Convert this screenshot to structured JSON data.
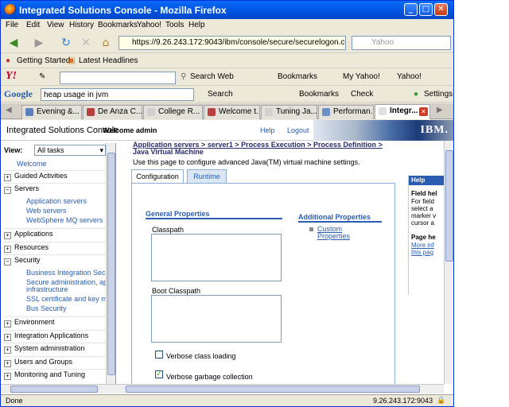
{
  "window": {
    "title": "Integrated Solutions Console - Mozilla Firefox"
  },
  "menu": {
    "items": [
      "File",
      "Edit",
      "View",
      "History",
      "Bookmarks",
      "Yahoo!",
      "Tools",
      "Help"
    ]
  },
  "navigation": {
    "url": "https://9.26.243.172:9043/ibm/console/secure/securelogon.c",
    "search_placeholder": "Yahoo"
  },
  "bookmarks_toolbar": {
    "getting_started": "Getting Started",
    "latest_headlines": "Latest Headlines"
  },
  "yahoo_toolbar": {
    "search_web": "Search Web",
    "bookmarks": "Bookmarks",
    "my_yahoo": "My Yahoo!",
    "yahoo": "Yahoo!"
  },
  "google_toolbar": {
    "query": "heap usage in jvm",
    "search": "Search",
    "bookmarks": "Bookmarks",
    "check": "Check",
    "settings": "Settings"
  },
  "tabs": [
    "Evening &...",
    "De Anza C...",
    "College R...",
    "Welcome t...",
    "Tuning Ja...",
    "Performan...",
    "Integr..."
  ],
  "console": {
    "title": "Integrated Solutions Console",
    "welcome": "Welcome admin",
    "help_link": "Help",
    "logout_link": "Logout",
    "brand": "IBM."
  },
  "sidebar": {
    "view_label": "View:",
    "view_value": "All tasks",
    "welcome": "Welcome",
    "categories": [
      {
        "label": "Guided Activities",
        "expanded": false
      },
      {
        "label": "Servers",
        "expanded": true,
        "children": [
          "Application servers",
          "Web servers",
          "WebSphere MQ servers"
        ]
      },
      {
        "label": "Applications",
        "expanded": false
      },
      {
        "label": "Resources",
        "expanded": false
      },
      {
        "label": "Security",
        "expanded": true,
        "children": [
          "Business Integration Secur",
          "Secure administration, appl",
          "infrastructure",
          "SSL certificate and key mar",
          "Bus Security"
        ]
      },
      {
        "label": "Environment",
        "expanded": false
      },
      {
        "label": "Integration Applications",
        "expanded": false
      },
      {
        "label": "System administration",
        "expanded": false
      },
      {
        "label": "Users and Groups",
        "expanded": false
      },
      {
        "label": "Monitoring and Tuning",
        "expanded": false
      }
    ]
  },
  "page": {
    "breadcrumb": [
      "Application servers",
      "server1",
      "Process Execution",
      "Process Definition"
    ],
    "breadcrumb_sep": ">",
    "breadcrumb_current": "Java Virtual Machine",
    "intro": "Use this page to configure advanced Java(TM) virtual machine settings.",
    "tabs": [
      "Configuration",
      "Runtime"
    ],
    "general_properties": "General Properties",
    "classpath_label": "Classpath",
    "boot_classpath_label": "Boot Classpath",
    "verbose_class_loading": {
      "label": "Verbose class loading",
      "checked": false
    },
    "verbose_gc": {
      "label": "Verbose garbage collection",
      "checked": true
    },
    "additional_properties": "Additional Properties",
    "custom_properties": [
      "Custom",
      "Properties"
    ]
  },
  "help": {
    "header": "Help",
    "field_help": "Field hel",
    "text_lines": [
      "For field",
      "select a",
      "marker v",
      "cursor a"
    ],
    "page_help": "Page he",
    "links": [
      "More inf",
      "this pag"
    ]
  },
  "status": {
    "left": "Done",
    "right": "9.26.243.172:9043"
  },
  "colors": {
    "link": "#2a5db0",
    "titlebar": "#0058e6",
    "ibm_banner": "#1d3a78"
  }
}
